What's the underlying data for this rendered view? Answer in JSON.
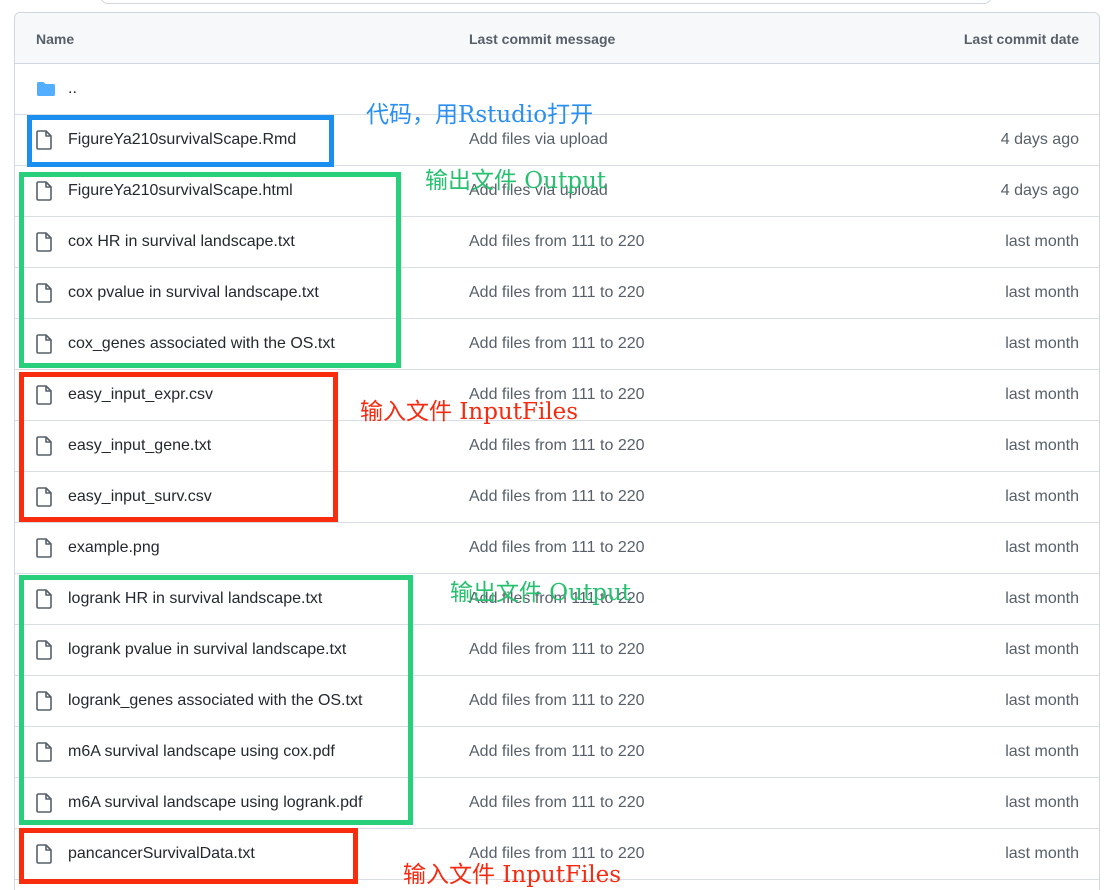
{
  "header": {
    "name_label": "Name",
    "message_label": "Last commit message",
    "date_label": "Last commit date"
  },
  "parent_dir": {
    "label": ".."
  },
  "files": [
    {
      "name": "FigureYa210survivalScape.Rmd",
      "message": "Add files via upload",
      "date": "4 days ago"
    },
    {
      "name": "FigureYa210survivalScape.html",
      "message": "Add files via upload",
      "date": "4 days ago"
    },
    {
      "name": "cox HR in survival landscape.txt",
      "message": "Add files from 111 to 220",
      "date": "last month"
    },
    {
      "name": "cox pvalue in survival landscape.txt",
      "message": "Add files from 111 to 220",
      "date": "last month"
    },
    {
      "name": "cox_genes associated with the OS.txt",
      "message": "Add files from 111 to 220",
      "date": "last month"
    },
    {
      "name": "easy_input_expr.csv",
      "message": "Add files from 111 to 220",
      "date": "last month"
    },
    {
      "name": "easy_input_gene.txt",
      "message": "Add files from 111 to 220",
      "date": "last month"
    },
    {
      "name": "easy_input_surv.csv",
      "message": "Add files from 111 to 220",
      "date": "last month"
    },
    {
      "name": "example.png",
      "message": "Add files from 111 to 220",
      "date": "last month"
    },
    {
      "name": "logrank HR in survival landscape.txt",
      "message": "Add files from 111 to 220",
      "date": "last month"
    },
    {
      "name": "logrank pvalue in survival landscape.txt",
      "message": "Add files from 111 to 220",
      "date": "last month"
    },
    {
      "name": "logrank_genes associated with the OS.txt",
      "message": "Add files from 111 to 220",
      "date": "last month"
    },
    {
      "name": "m6A survival landscape using cox.pdf",
      "message": "Add files from 111 to 220",
      "date": "last month"
    },
    {
      "name": "m6A survival landscape using logrank.pdf",
      "message": "Add files from 111 to 220",
      "date": "last month"
    },
    {
      "name": "pancancerSurvivalData.txt",
      "message": "Add files from 111 to 220",
      "date": "last month"
    }
  ],
  "annotations": {
    "code": "代码，用Rstudio打开",
    "output_1": "输出文件 Output",
    "input_1": "输入文件 InputFiles",
    "output_2": "输出文件 Output",
    "input_2": "输入文件 InputFiles"
  },
  "colors": {
    "blue_box": "#1b8ff0",
    "green_box": "#29d07c",
    "red_box": "#fa2c0e",
    "folder": "#54aeff"
  },
  "icons": {
    "folder": "folder-icon",
    "file": "file-icon"
  }
}
